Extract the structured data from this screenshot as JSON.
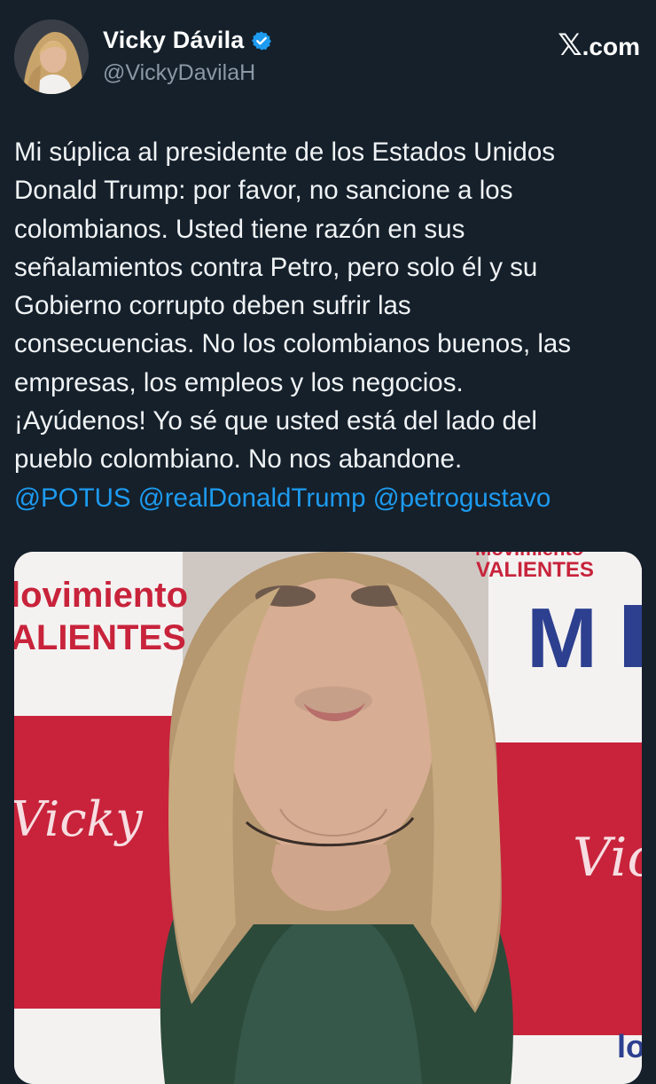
{
  "author": {
    "display_name": "Vicky Dávila",
    "handle": "@VickyDavilaH",
    "verified_icon": "verified-badge-icon"
  },
  "brand": {
    "glyph": "𝕏",
    "label": ".com"
  },
  "tweet": {
    "lines": [
      "Mi súplica al presidente de los Estados Unidos",
      "Donald Trump: por favor, no sancione a los",
      "colombianos. Usted tiene razón en sus",
      "señalamientos contra Petro, pero solo él y su",
      "Gobierno corrupto deben sufrir las",
      "consecuencias. No los colombianos buenos, las",
      "empresas, los empleos y los negocios.",
      "¡Ayúdenos! Yo sé que usted está del lado del",
      "pueblo colombiano. No nos abandone."
    ],
    "mentions": [
      "@POTUS",
      "@realDonaldTrump",
      "@petrogustavo"
    ]
  },
  "media": {
    "banner_left_line1": "lovimiento",
    "banner_left_line2": "ALIENTES",
    "banner_top_line1": "Movimiento",
    "banner_top_line2": "VALIENTES",
    "banner_bottom": "lovi",
    "script_left": "Vicky",
    "script_right": "Vic",
    "logo_letter": "M"
  },
  "colors": {
    "background": "#15202b",
    "mention": "#1d9bf0",
    "verified": "#1d9bf0",
    "handle": "#8b98a5",
    "banner_red": "#c8233b",
    "banner_blue": "#2d3f8f"
  }
}
